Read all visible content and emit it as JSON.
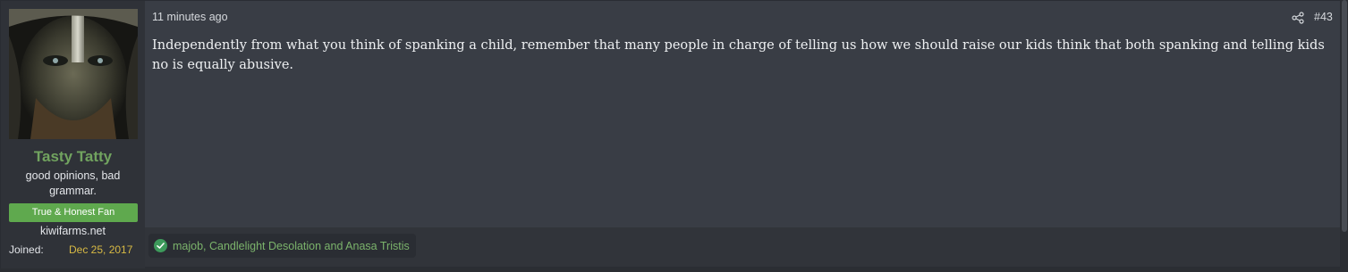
{
  "user": {
    "username": "Tasty Tatty",
    "title": "good opinions, bad grammar.",
    "banner": "True & Honest Fan",
    "site": "kiwifarms.net",
    "joined_label": "Joined:",
    "joined_date": "Dec 25, 2017"
  },
  "post": {
    "timestamp": "11 minutes ago",
    "number": "#43",
    "body": "Independently from what you think of spanking a child, remember that many people in charge of telling us how we should raise our kids think that both spanking and telling kids no is equally abusive."
  },
  "reactions": {
    "names": "majob, Candlelight Desolation and Anasa Tristis"
  },
  "colors": {
    "username": "#71a35f",
    "banner": "#5fa94e",
    "joined_date": "#d7b944",
    "reaction_text": "#7bb36b"
  },
  "icons": [
    "share-icon",
    "check-icon"
  ]
}
